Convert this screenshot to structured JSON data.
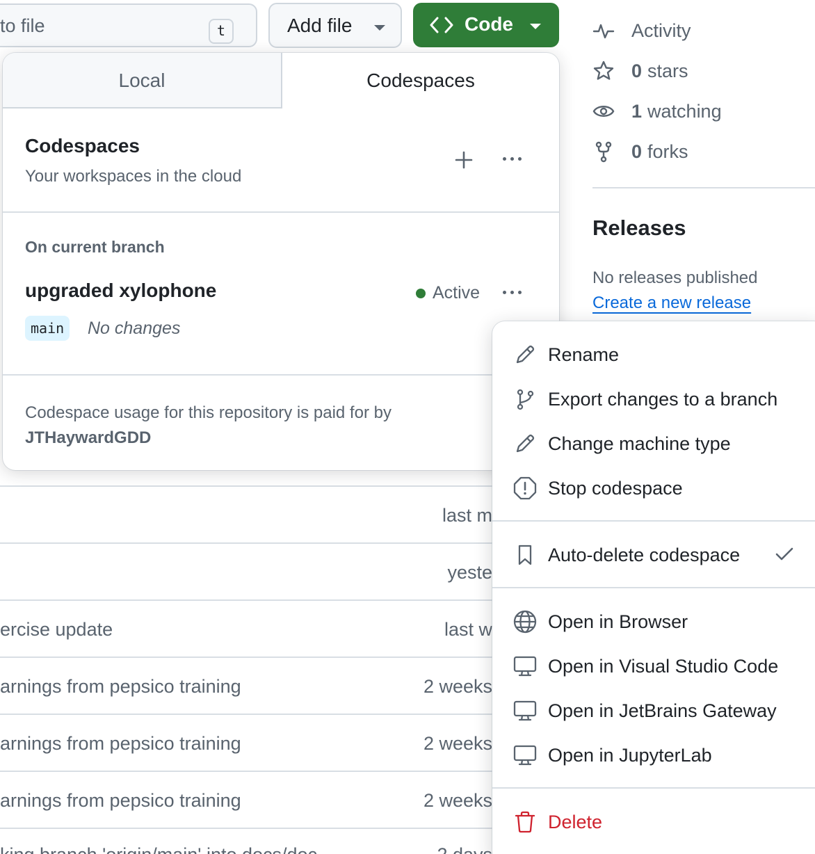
{
  "toolbar": {
    "goto_file": "to file",
    "goto_file_shortcut": "t",
    "add_file": "Add file",
    "code": "Code"
  },
  "sidebar": {
    "activity": "Activity",
    "stars_count": "0",
    "stars_label": "stars",
    "watching_count": "1",
    "watching_label": "watching",
    "forks_count": "0",
    "forks_label": "forks",
    "releases_title": "Releases",
    "no_releases": "No releases published",
    "create_release": "Create a new release"
  },
  "panel": {
    "tabs": [
      "Local",
      "Codespaces"
    ],
    "title": "Codespaces",
    "subtitle": "Your workspaces in the cloud",
    "section": "On current branch",
    "codespace": {
      "name": "upgraded xylophone",
      "status": "Active",
      "branch": "main",
      "changes": "No changes"
    },
    "footer_text": "Codespace usage for this repository is paid for by",
    "footer_owner": "JTHaywardGDD"
  },
  "menu": {
    "rename": "Rename",
    "export": "Export changes to a branch",
    "change_machine": "Change machine type",
    "stop": "Stop codespace",
    "auto_delete": "Auto-delete codespace",
    "open_browser": "Open in Browser",
    "open_vscode": "Open in Visual Studio Code",
    "open_jetbrains": "Open in JetBrains Gateway",
    "open_jupyter": "Open in JupyterLab",
    "delete": "Delete"
  },
  "background_rows": [
    {
      "message": "",
      "time": "last m"
    },
    {
      "message": "",
      "time": "yeste"
    },
    {
      "message": "ercise update",
      "time": "last w"
    },
    {
      "message": "arnings from pepsico training",
      "time": "2 weeks"
    },
    {
      "message": "arnings from pepsico training",
      "time": "2 weeks"
    },
    {
      "message": "arnings from pepsico training",
      "time": "2 weeks"
    },
    {
      "message": "king branch 'origin/main' into docs/doc",
      "time": "2 days"
    }
  ],
  "colors": {
    "primary_green": "#2f7d38",
    "danger": "#cf222e",
    "link": "#0969da",
    "muted": "#59636e",
    "branch_bg": "#ddf4ff"
  }
}
